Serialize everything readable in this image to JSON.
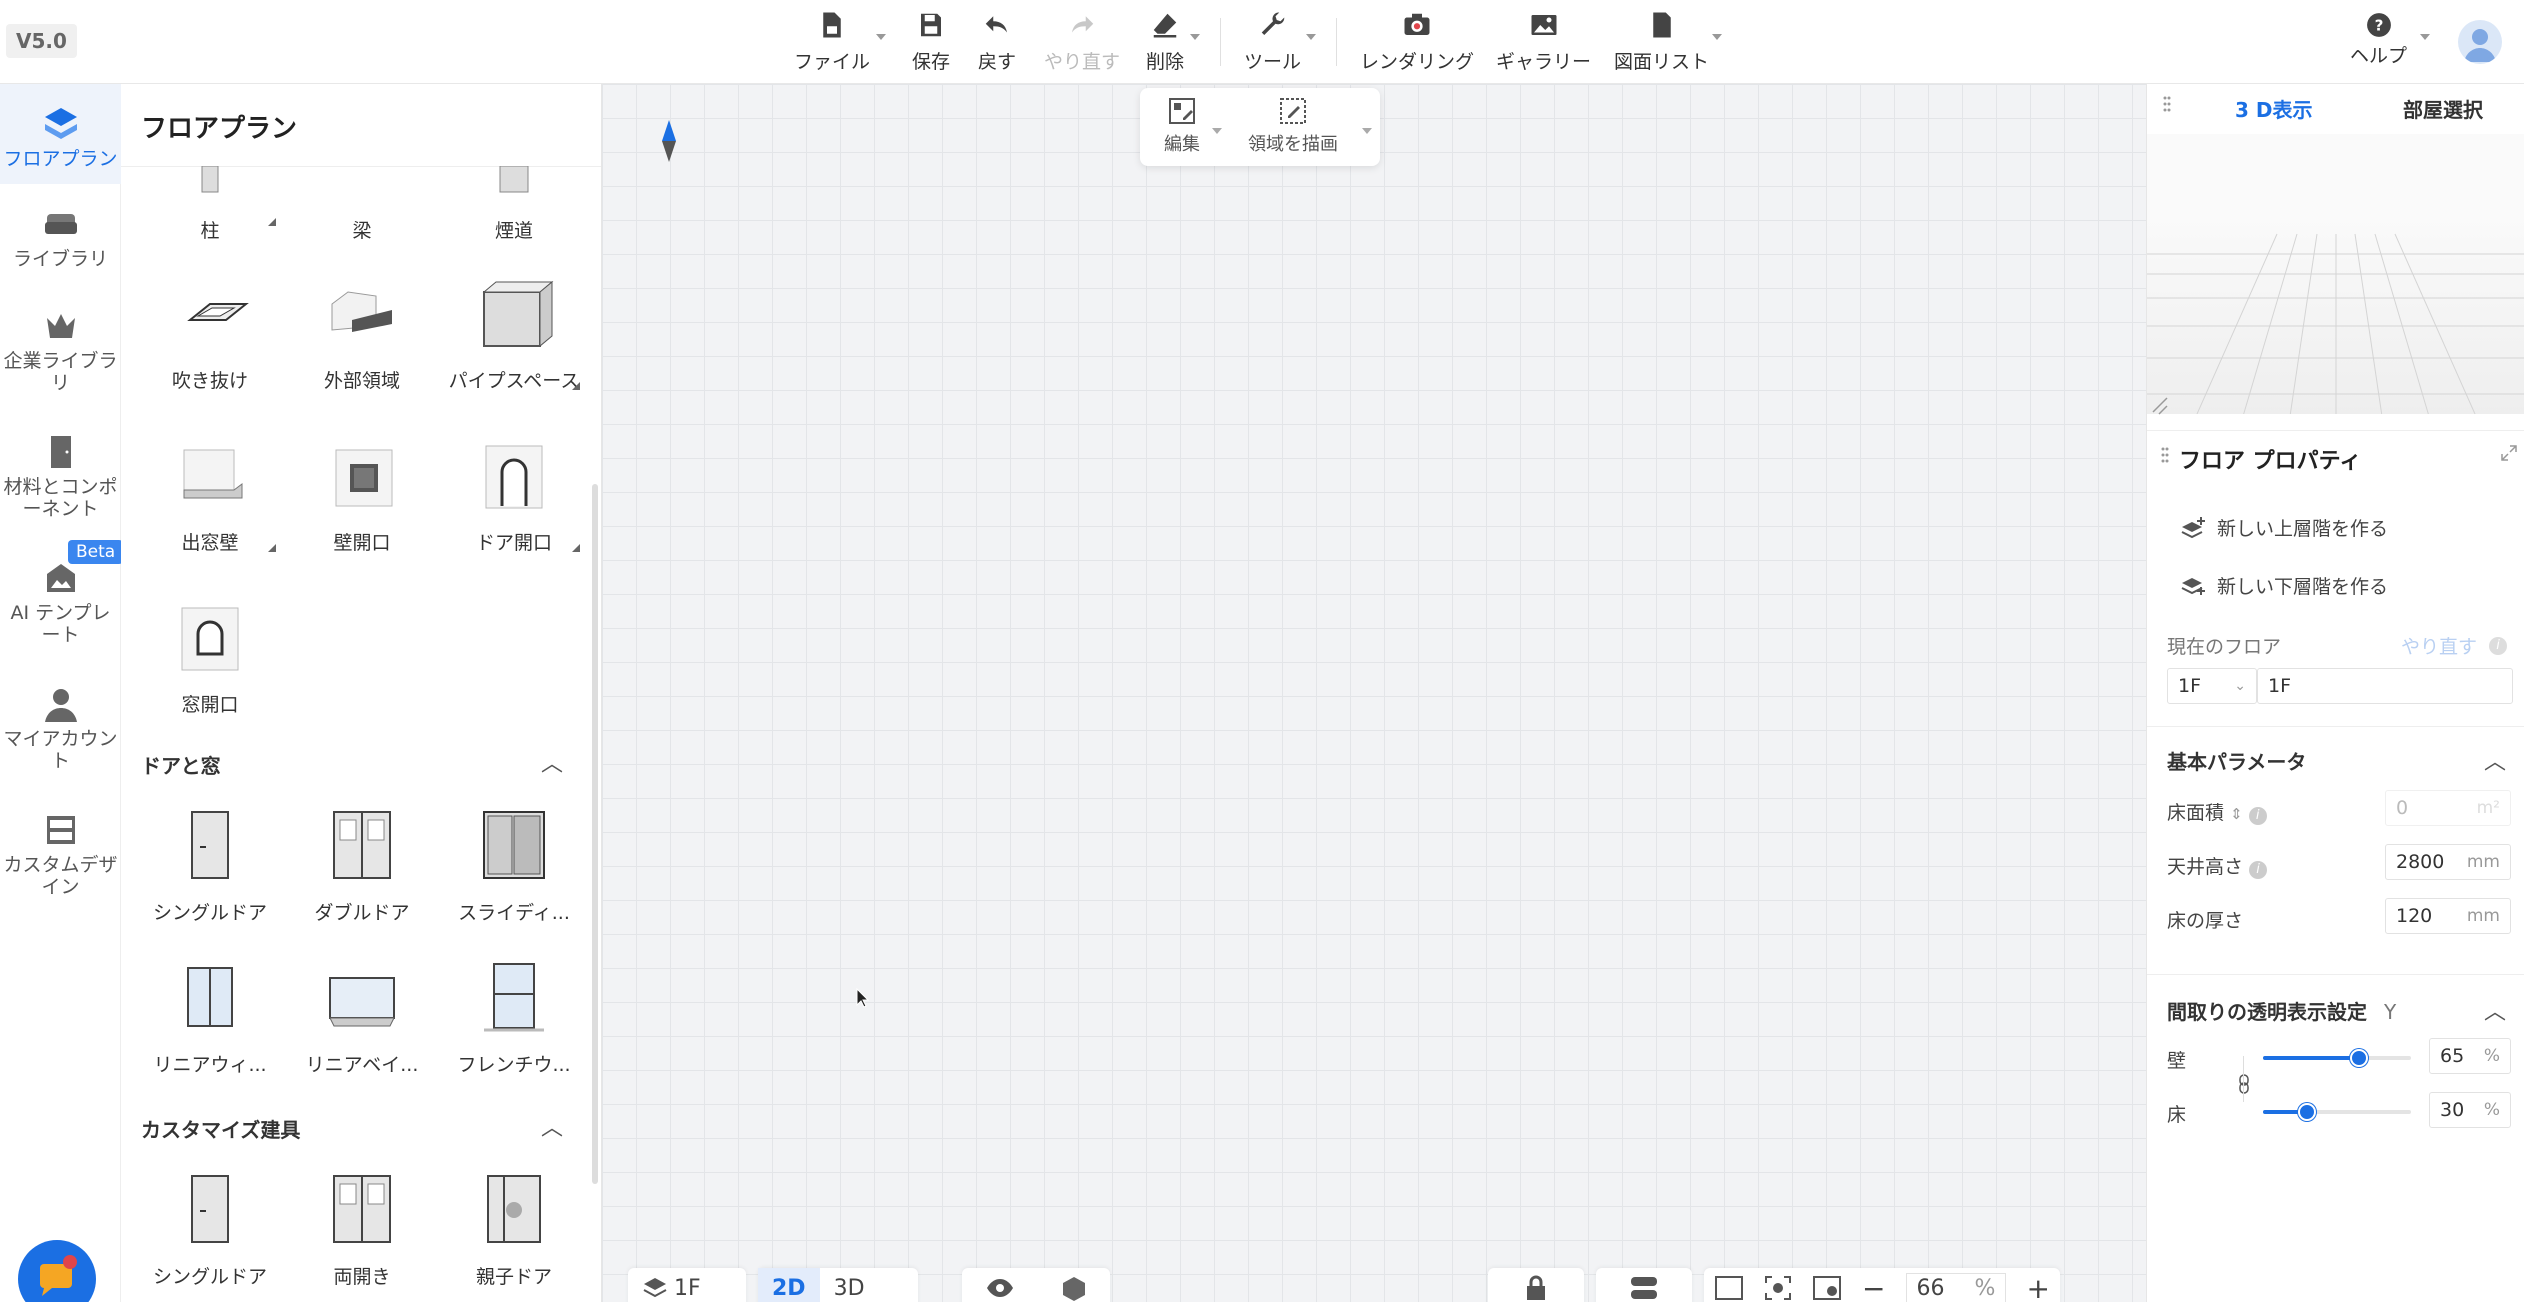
{
  "version": "V5.0",
  "toolbar": {
    "file": "ファイル",
    "save": "保存",
    "undo": "戻す",
    "redo": "やり直す",
    "delete": "削除",
    "tools": "ツール",
    "rendering": "レンダリング",
    "gallery": "ギャラリー",
    "drawing_list": "図面リスト",
    "help": "ヘルプ"
  },
  "leftnav": {
    "items": [
      {
        "label": "フロアプラン"
      },
      {
        "label": "ライブラリ"
      },
      {
        "label": "企業ライブラリ"
      },
      {
        "label": "材料とコンポーネント"
      },
      {
        "label": "AI テンプレート"
      },
      {
        "label": "マイアカウント"
      },
      {
        "label": "カスタムデザイン"
      }
    ],
    "beta": "Beta",
    "chat_badge": "1"
  },
  "panel": {
    "title": "フロアプラン",
    "items_top": [
      {
        "label": "柱"
      },
      {
        "label": "梁"
      },
      {
        "label": "煙道"
      },
      {
        "label": "吹き抜け"
      },
      {
        "label": "外部領域"
      },
      {
        "label": "パイプスペース"
      },
      {
        "label": "出窓壁"
      },
      {
        "label": "壁開口"
      },
      {
        "label": "ドア開口"
      },
      {
        "label": "窓開口"
      }
    ],
    "section_doors": "ドアと窓",
    "doors": [
      {
        "label": "シングルドア"
      },
      {
        "label": "ダブルドア"
      },
      {
        "label": "スライディ..."
      },
      {
        "label": "リニアウィ..."
      },
      {
        "label": "リニアベイ..."
      },
      {
        "label": "フレンチウ..."
      }
    ],
    "section_custom": "カスタマイズ建具",
    "custom": [
      {
        "label": "シングルドア"
      },
      {
        "label": "両開き"
      },
      {
        "label": "親子ドア"
      }
    ]
  },
  "canvas": {
    "edit": "編集",
    "draw_area": "領域を描画",
    "floor": "1F",
    "mode_2d": "2D",
    "mode_3d": "3D",
    "zoom": "66",
    "zoom_unit": "%"
  },
  "right": {
    "tab_3d": "3 D表示",
    "tab_room": "部屋選択",
    "props_title": "フロア プロパティ",
    "new_upper": "新しい上層階を作る",
    "new_lower": "新しい下層階を作る",
    "current_floor_label": "現在のフロア",
    "current_floor_redo": "やり直す",
    "floor_select": "1F",
    "floor_name": "1F",
    "basic_params": "基本パラメータ",
    "floor_area_label": "床面積",
    "floor_area_value": "0",
    "floor_area_unit": "m²",
    "ceiling_label": "天井高さ",
    "ceiling_value": "2800",
    "ceiling_unit": "mm",
    "thickness_label": "床の厚さ",
    "thickness_value": "120",
    "thickness_unit": "mm",
    "transparency_title": "間取りの透明表示設定",
    "transparency_key": "Y",
    "wall_label": "壁",
    "wall_value": "65",
    "floor_label": "床",
    "floor_value": "30",
    "pct": "%",
    "colors": {
      "accent": "#1b6fe3"
    }
  }
}
